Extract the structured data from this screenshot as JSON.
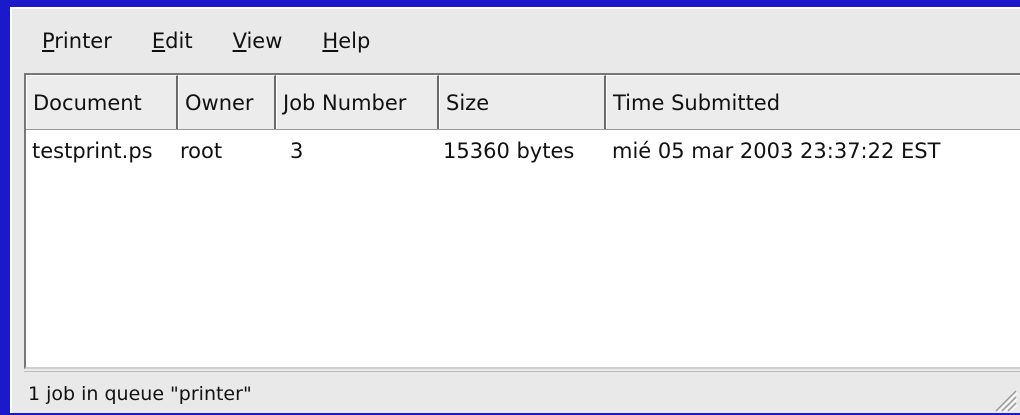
{
  "menubar": {
    "items": [
      {
        "label": "Printer",
        "mnemonic": "P",
        "rest": "rinter"
      },
      {
        "label": "Edit",
        "mnemonic": "E",
        "rest": "dit"
      },
      {
        "label": "View",
        "mnemonic": "V",
        "rest": "iew"
      },
      {
        "label": "Help",
        "mnemonic": "H",
        "rest": "elp"
      }
    ]
  },
  "table": {
    "columns": [
      "Document",
      "Owner",
      "Job Number",
      "Size",
      "Time Submitted"
    ],
    "rows": [
      {
        "document": "testprint.ps",
        "owner": "root",
        "job_number": "3",
        "size": "15360 bytes",
        "time_submitted": "mié 05 mar 2003 23:37:22 EST"
      }
    ]
  },
  "status": {
    "text": "1 job in queue \"printer\""
  },
  "colors": {
    "desktop": "#1a1acb",
    "window_bg": "#e9e9e9",
    "list_bg": "#ffffff"
  }
}
